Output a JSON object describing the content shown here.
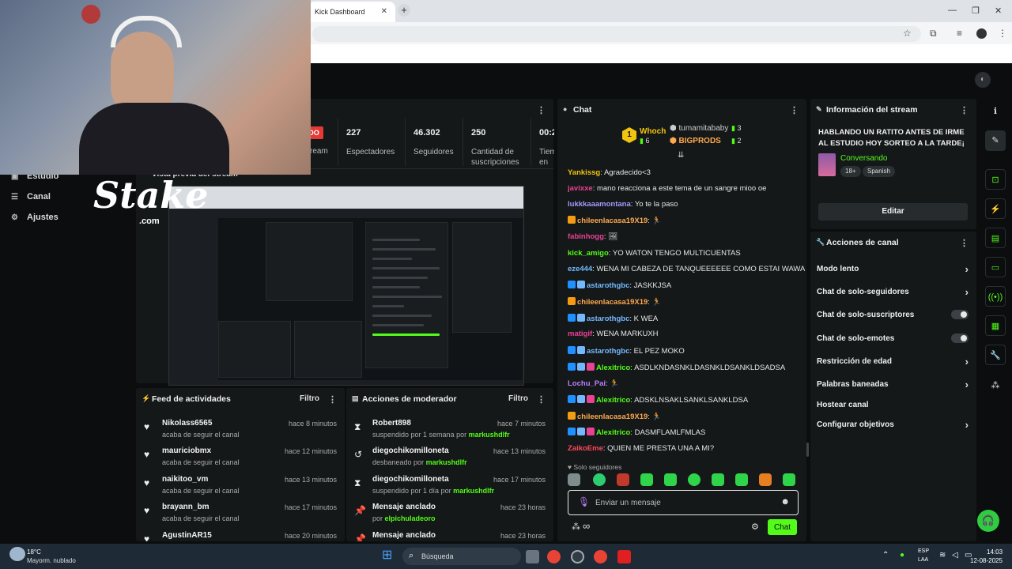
{
  "browser": {
    "tab_title": "Kick Dashboard",
    "tab_close": "✕",
    "new_tab": "+",
    "win_min": "—",
    "win_restore": "❐",
    "win_close": "✕"
  },
  "stream_panel": {
    "live_badge": "DO",
    "stream_label": "ream",
    "stats": [
      {
        "value": "227",
        "label": "Espectadores"
      },
      {
        "value": "46.302",
        "label": "Seguidores"
      },
      {
        "value": "250",
        "label": "Cantidad de suscripciones"
      },
      {
        "value": "00:2",
        "label": "Tiem en vi"
      }
    ]
  },
  "sidebar": {
    "items": [
      {
        "label": "Estudio",
        "icon": "studio-icon"
      },
      {
        "label": "Canal",
        "icon": "channel-icon"
      },
      {
        "label": "Ajustes",
        "icon": "gear-icon"
      }
    ]
  },
  "overlay": {
    "brand": "Stake",
    "brand_sub": ".com"
  },
  "preview": {
    "title": "Vista previa del stream"
  },
  "activity_feed": {
    "title": "Feed de actividades",
    "filter": "Filtro",
    "rows": [
      {
        "name": "Nikolass6565",
        "sub": "acaba de seguir el canal",
        "time": "hace 8 minutos"
      },
      {
        "name": "mauriciobmx",
        "sub": "acaba de seguir el canal",
        "time": "hace 12 minutos"
      },
      {
        "name": "naikitoo_vm",
        "sub": "acaba de seguir el canal",
        "time": "hace 13 minutos"
      },
      {
        "name": "brayann_bm",
        "sub": "acaba de seguir el canal",
        "time": "hace 17 minutos"
      },
      {
        "name": "AgustinAR15",
        "sub": "",
        "time": "hace 20 minutos"
      }
    ]
  },
  "mod_actions": {
    "title": "Acciones de moderador",
    "filter": "Filtro",
    "rows": [
      {
        "icon": "hourglass-icon",
        "name": "Robert898",
        "sub_pre": "suspendido por 1 semana por ",
        "sub_user": "markushdlfr",
        "time": "hace 7 minutos"
      },
      {
        "icon": "unban-icon",
        "name": "diegochikomilloneta",
        "sub_pre": "desbaneado por ",
        "sub_user": "markushdlfr",
        "time": "hace 13 minutos"
      },
      {
        "icon": "hourglass-icon",
        "name": "diegochikomilloneta",
        "sub_pre": "suspendido por 1 día por ",
        "sub_user": "markushdlfr",
        "time": "hace 17 minutos"
      },
      {
        "icon": "pin-icon",
        "name": "Mensaje anclado",
        "sub_pre": "por ",
        "sub_user": "elpichuladeoro",
        "time": "hace 23 horas"
      },
      {
        "icon": "pin-icon",
        "name": "Mensaje anclado",
        "sub_pre": "",
        "sub_user": "",
        "time": "hace 23 horas"
      }
    ]
  },
  "chat": {
    "title": "Chat",
    "leaderboard": [
      {
        "rank": "1",
        "name": "Whoch",
        "count": "6"
      },
      {
        "name": "tumamitababy",
        "count": "3"
      },
      {
        "name": "BIGPRODS",
        "count": "2"
      }
    ],
    "messages": [
      {
        "user": "Yankissg",
        "color": "#f1c40f",
        "text": "Agradecido<3"
      },
      {
        "user": "javixxe",
        "color": "#e84393",
        "text": "mano reacciona a este tema de un sangre mioo oe"
      },
      {
        "user": "lukkkaaamontana",
        "color": "#a29bfe",
        "text": "Yo te la paso"
      },
      {
        "user": "chileenlacasa19X19",
        "color": "#ffa94d",
        "text": "🏃"
      },
      {
        "user": "fabinhogg",
        "color": "#e84393",
        "text": "🖼"
      },
      {
        "user": "kick_amigo",
        "color": "#53fc18",
        "text": "YO WATON TENGO MULTICUENTAS"
      },
      {
        "user": "eze444",
        "color": "#74b9ff",
        "text": "WENA MI CABEZA DE TANQUEEEEEE COMO ESTAI WAWA"
      },
      {
        "user": "astarothgbc",
        "color": "#74b9ff",
        "text": "JASKKJSA"
      },
      {
        "user": "chileenlacasa19X19",
        "color": "#ffa94d",
        "text": "🏃"
      },
      {
        "user": "astarothgbc",
        "color": "#74b9ff",
        "text": "K WEA"
      },
      {
        "user": "matigif",
        "color": "#e84393",
        "text": "WENA MARKUXH"
      },
      {
        "user": "astarothgbc",
        "color": "#74b9ff",
        "text": "EL PEZ MOKO"
      },
      {
        "user": "Alexitrico",
        "color": "#53fc18",
        "text": "ASDLKNDASNKLDASNKLDSANKLDSADSA"
      },
      {
        "user": "Lochu_Pai",
        "color": "#b980ff",
        "text": "🏃"
      },
      {
        "user": "Alexitrico",
        "color": "#53fc18",
        "text": "ADSKLNSAKLSANKLSANKLDSA"
      },
      {
        "user": "chileenlacasa19X19",
        "color": "#ffa94d",
        "text": "🏃"
      },
      {
        "user": "Alexitrico",
        "color": "#53fc18",
        "text": "DASMFLAMLFMLAS"
      },
      {
        "user": "ZaikoEme",
        "color": "#ff4757",
        "text": "QUIEN ME PRESTA UNA A MI?"
      }
    ],
    "followers_only": "Solo seguidores",
    "input_placeholder": "Enviar un mensaje",
    "send_label": "Chat"
  },
  "stream_info": {
    "title": "Información del stream",
    "stream_title": "HABLANDO UN RATITO ANTES DE IRME AL ESTUDIO HOY SORTEO A LA TARDE¡",
    "category": "Conversando",
    "tags": [
      "18+",
      "Spanish"
    ],
    "edit_label": "Editar"
  },
  "channel_actions": {
    "title": "Acciones de canal",
    "rows": [
      {
        "label": "Modo lento",
        "control": "chevron"
      },
      {
        "label": "Chat de solo-seguidores",
        "control": "chevron"
      },
      {
        "label": "Chat de solo-suscriptores",
        "control": "toggle"
      },
      {
        "label": "Chat de solo-emotes",
        "control": "toggle"
      },
      {
        "label": "Restricción de edad",
        "control": "chevron"
      },
      {
        "label": "Palabras baneadas",
        "control": "chevron"
      },
      {
        "label": "Hostear canal",
        "control": "none"
      },
      {
        "label": "Configurar objetivos",
        "control": "chevron"
      }
    ]
  },
  "taskbar": {
    "weather_temp": "18°C",
    "weather_desc": "Mayorm. nublado",
    "search": "Búsqueda",
    "lang": "ESP",
    "lang2": "LAA",
    "time": "14:03",
    "date": "12-08-2025"
  },
  "colors": {
    "accent": "#53fc18",
    "panel": "#151819",
    "background": "#0b0d0e"
  }
}
